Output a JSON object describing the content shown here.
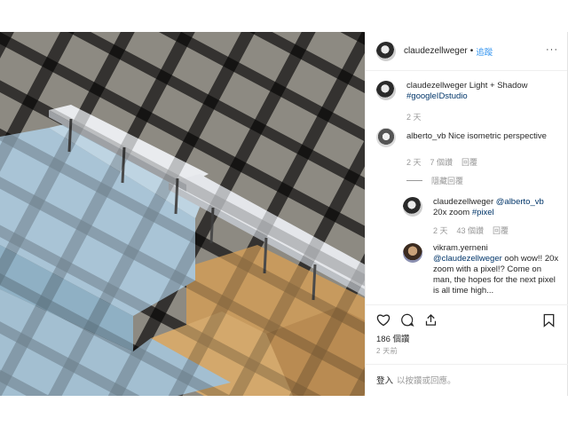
{
  "header": {
    "username": "claudezellweger",
    "separator": "•",
    "follow_label": "追蹤",
    "more_label": "···"
  },
  "comments": [
    {
      "username": "claudezellweger",
      "text": "Light + Shadow",
      "hashtag": "#googleIDstudio",
      "time": "2 天"
    },
    {
      "username": "alberto_vb",
      "text": "Nice isometric perspective",
      "time": "2 天",
      "likes": "7 個讚",
      "reply_label": "回覆",
      "replies_toggle": "隱藏回覆"
    }
  ],
  "replies": [
    {
      "username": "claudezellweger",
      "mention": "@alberto_vb",
      "text_line1": "20x zoom",
      "hashtag": "#pixel",
      "time": "2 天",
      "likes": "43 個讚",
      "reply_label": "回覆"
    },
    {
      "username": "vikram.yerneni",
      "mention": "@claudezellweger",
      "text": "ooh wow!! 20x zoom with a pixel!? Come on man, the hopes for the next pixel is all time high..."
    }
  ],
  "actions": {
    "icons": [
      "heart-icon",
      "comment-icon",
      "share-icon",
      "bookmark-icon"
    ]
  },
  "likes_text": "186 個讚",
  "date_text": "2 天前",
  "login": {
    "login_label": "登入",
    "prompt": "以按讚或回應。"
  },
  "colors": {
    "link": "#003569",
    "follow": "#3897f0",
    "muted": "#999999",
    "text": "#262626",
    "bench_blue": "#a9c4d6",
    "wood": "#c79a5e",
    "floor": "#7a766e"
  }
}
